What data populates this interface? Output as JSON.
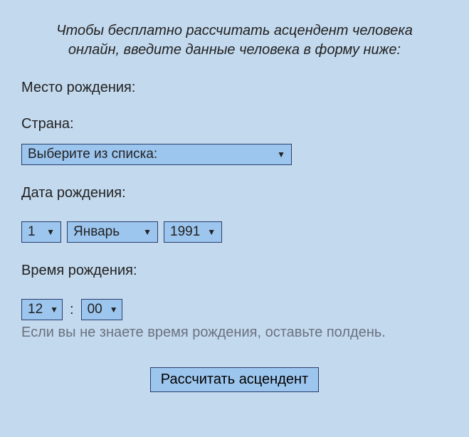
{
  "instruction": "Чтобы бесплатно рассчитать асцендент человека онлайн, введите данные человека в форму ниже:",
  "birthplace": {
    "label": "Место рождения:"
  },
  "country": {
    "label": "Страна:",
    "selected": "Выберите из списка:"
  },
  "birthdate": {
    "label": "Дата рождения:",
    "day": "1",
    "month": "Январь",
    "year": "1991"
  },
  "birthtime": {
    "label": "Время рождения:",
    "hour": "12",
    "minute": "00",
    "hint": "Если вы не знаете время рождения, оставьте полдень."
  },
  "submit": {
    "label": "Рассчитать асцендент"
  }
}
